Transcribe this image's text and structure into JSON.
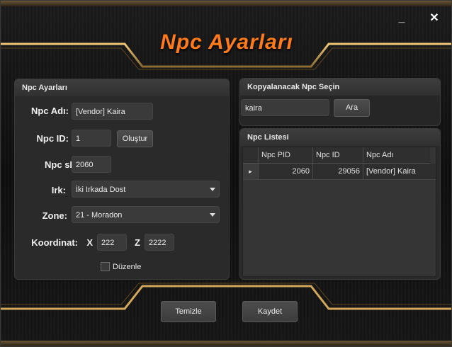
{
  "window": {
    "title": "Npc Ayarları",
    "minimize_label": "_",
    "close_label": "✕"
  },
  "npc_settings": {
    "header": "Npc Ayarları",
    "name_label": "Npc Adı:",
    "name_value": "[Vendor] Kaira",
    "id_label": "Npc ID:",
    "id_value": "1",
    "generate_button": "Oluştur",
    "spid_label": "Npc sPid:",
    "spid_value": "2060",
    "race_label": "Irk:",
    "race_value": "İki Irkada Dost",
    "zone_label": "Zone:",
    "zone_value": "21 - Moradon",
    "coord_label": "Koordinat:",
    "x_label": "X",
    "x_value": "222",
    "z_label": "Z",
    "z_value": "2222",
    "edit_label": "Düzenle",
    "edit_checked": false
  },
  "copy_npc": {
    "header": "Kopyalanacak Npc Seçin",
    "search_value": "kaira",
    "search_button": "Ara"
  },
  "npc_list": {
    "header": "Npc Listesi",
    "columns": [
      "Npc PID",
      "Npc ID",
      "Npc Adı"
    ],
    "rows": [
      {
        "pid": "2060",
        "id": "29056",
        "name": "[Vendor] Kaira"
      }
    ]
  },
  "footer": {
    "clear_button": "Temizle",
    "save_button": "Kaydet"
  },
  "colors": {
    "title": "#ff7a1a",
    "gold": "#c8a060"
  }
}
